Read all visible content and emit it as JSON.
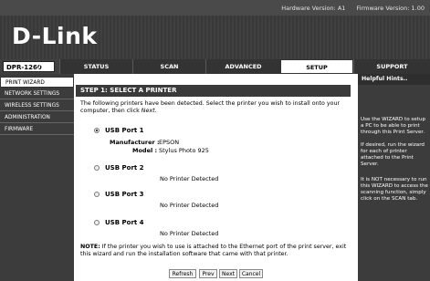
{
  "topbar": {
    "hardware": "Hardware Version: A1",
    "firmware": "Firmware Version: 1.00"
  },
  "brand": {
    "logo": "D-Link",
    "model": "DPR-1260"
  },
  "tabs": [
    {
      "label": "STATUS"
    },
    {
      "label": "SCAN"
    },
    {
      "label": "ADVANCED"
    },
    {
      "label": "SETUP"
    },
    {
      "label": "SUPPORT"
    }
  ],
  "sidebar": {
    "items": [
      {
        "label": "PRINT WIZARD"
      },
      {
        "label": "NETWORK SETTINGS"
      },
      {
        "label": "WIRELESS SETTINGS"
      },
      {
        "label": "ADMINISTRATION"
      },
      {
        "label": "FIRMWARE"
      }
    ]
  },
  "main": {
    "step_title": "STEP 1: SELECT A PRINTER",
    "intro": "The following printers have been detected.  Select the printer you wish to install onto your computer, then click ",
    "intro_em": "Next",
    "ports": [
      {
        "label": "USB Port 1",
        "manufacturer_label": "Manufacturer :",
        "manufacturer": "EPSON",
        "model_label": "Model :",
        "model": "Stylus Photo 925"
      },
      {
        "label": "USB Port 2",
        "status": "No Printer Detected"
      },
      {
        "label": "USB Port 3",
        "status": "No Printer Detected"
      },
      {
        "label": "USB Port 4",
        "status": "No Printer Detected"
      }
    ],
    "note_label": "NOTE:",
    "note": " If the printer you wish to use is attached to the Ethernet port of the print server, exit this wizard and run the installation software that came with that printer.",
    "buttons": {
      "refresh": "Refresh",
      "prev": "Prev",
      "next": "Next",
      "cancel": "Cancel"
    }
  },
  "help": {
    "title": "Helpful Hints..",
    "p1": "Use the WIZARD to setup a PC to be able to print through this Print Server.",
    "p2": "If desired, run the wizard for each of printer attached to the Print Server.",
    "p3": "It is NOT necessary to run this WIZARD to access the scanning function, simply click on the SCAN tab."
  }
}
